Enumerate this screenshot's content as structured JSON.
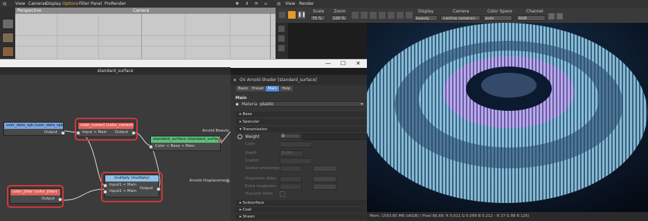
{
  "c4d": {
    "menu": [
      "View",
      "Cameras",
      "Display",
      "Options",
      "Filter",
      "Panel",
      "ProRender"
    ],
    "viewport_label": "Perspective",
    "camera_label": "Camera"
  },
  "render_view": {
    "menu": [
      "View",
      "Render"
    ],
    "scale_label": "Scale",
    "scale_value": "75 %",
    "zoom_label": "Zoom",
    "zoom_value": "100 %",
    "display_label": "Display",
    "display_value": "beauty",
    "camera_label": "Camera",
    "camera_value": "<active camera>",
    "colorspace_label": "Color Space",
    "colorspace_value": "auto",
    "channel_label": "Channel",
    "channel_value": "RGB",
    "status": "Mem: 1593.85 MB  (sRGB) / Pixel 66,69: R 0.011 G 0.099 B 0.212 - R 27 G 88 B 126)"
  },
  "node_editor": {
    "title": "standard_surface",
    "nodes": {
      "user_data": {
        "title": "user_data_rgb (user_data_rgb)",
        "out": "Output"
      },
      "color_correct": {
        "title": "color_correct (color_correct)",
        "in": "Input < Main",
        "out": "Output"
      },
      "standard_surface": {
        "title": "standard_surface (standard_surface)",
        "in": "Color < Base < Main",
        "out": "Output"
      },
      "multiply": {
        "title": "multiply (multiply)",
        "in1": "Input1 < Main",
        "in2": "Input2 < Main",
        "out": "Output"
      },
      "color_jitter": {
        "title": "color_jitter (color_jitter)",
        "out": "Output"
      }
    },
    "side_labels": {
      "beauty": "Arnold Beauty",
      "displacement": "Arnold Displacement"
    }
  },
  "attributes": {
    "header": "GV Arnold Shader [standard_surface]",
    "tabs": [
      "Basic",
      "Preset",
      "Main",
      "Help"
    ],
    "section_title": "Main",
    "material_label": "Material",
    "material_value": "plastic",
    "sections": [
      "Base",
      "Specular",
      "Transmission"
    ],
    "weight_label": "Weight",
    "weight_value": "0",
    "params": [
      "Color",
      "Depth",
      "Scatter",
      "Scatter anisotropy",
      "Dispersion Abbe",
      "Extra roughness",
      "Transmit AOVs"
    ],
    "depth_value": "0 cm",
    "sections_bottom": [
      "Subsurface",
      "Coat",
      "Sheen"
    ]
  },
  "colors": {
    "highlight": "#d13a3a",
    "accent": "#4f8bd6"
  }
}
